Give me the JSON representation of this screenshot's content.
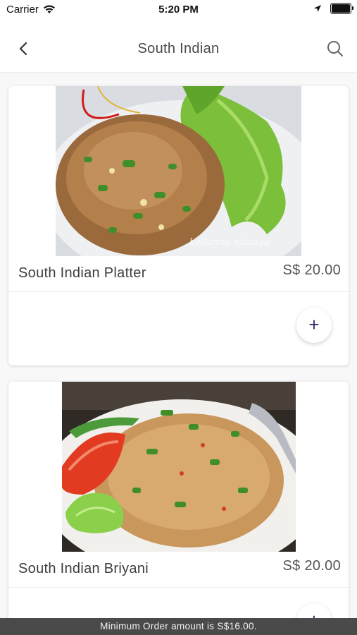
{
  "status_bar": {
    "carrier": "Carrier",
    "time": "5:20 PM"
  },
  "header": {
    "title": "South Indian",
    "back_icon": "chevron-left-icon",
    "search_icon": "search-icon"
  },
  "menu_items": [
    {
      "name": "South Indian Platter",
      "price": "S$ 20.00",
      "add_label": "+",
      "watermark": "bellarina natasya"
    },
    {
      "name": "South Indian Briyani",
      "price": "S$ 20.00",
      "add_label": "+"
    }
  ],
  "footer": {
    "min_order_text": "Minimum Order amount is S$16.00."
  },
  "colors": {
    "accent": "#2d2b6b",
    "banner_bg": "#4a4a4a"
  }
}
